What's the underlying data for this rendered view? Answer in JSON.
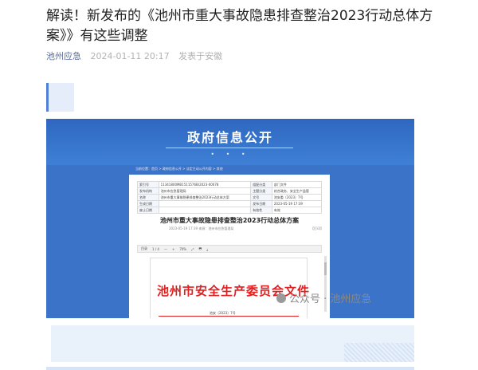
{
  "article": {
    "title": "解读！新发布的《池州市重大事故隐患排查整治2023行动总体方案》》有这些调整",
    "author": "池州应急",
    "date": "2024-01-11 20:17",
    "location": "发表于安徽"
  },
  "image": {
    "banner_title": "政府信息公开",
    "breadcrumb": "当前位置：首页 > 政府信息公开 > 法定主动公开内容 > 其他",
    "info_rows": [
      [
        "索引号",
        "11341800MB1511576B/2023-00078",
        "组配分类",
        "部门文件"
      ],
      [
        "发布机构",
        "池州市应急管理局",
        "主题分类",
        "综合政务、安全生产监管"
      ],
      [
        "名称",
        "池州市重大事故隐患排查整治2023行动总体方案",
        "文号",
        "池安委〔2023〕7号"
      ],
      [
        "生成日期",
        "",
        "发布日期",
        "2023-05-19 17:39"
      ],
      [
        "废止日期",
        "",
        "有效性",
        "有效"
      ]
    ],
    "doc_title": "池州市重大事故隐患排查整治2023行动总体方案",
    "doc_sub": "2023-05-19 17:39  来源：池州市应急管理局",
    "doc_print": "【打印】",
    "toolbar": [
      "目录",
      "1 / 4",
      "—",
      "+",
      "70%",
      "⤢",
      "🖶",
      "⤓"
    ],
    "red_header": "池州市安全生产委员会文件",
    "red_num": "池安〔2023〕7号"
  },
  "watermark": "公众号 · 池州应急"
}
